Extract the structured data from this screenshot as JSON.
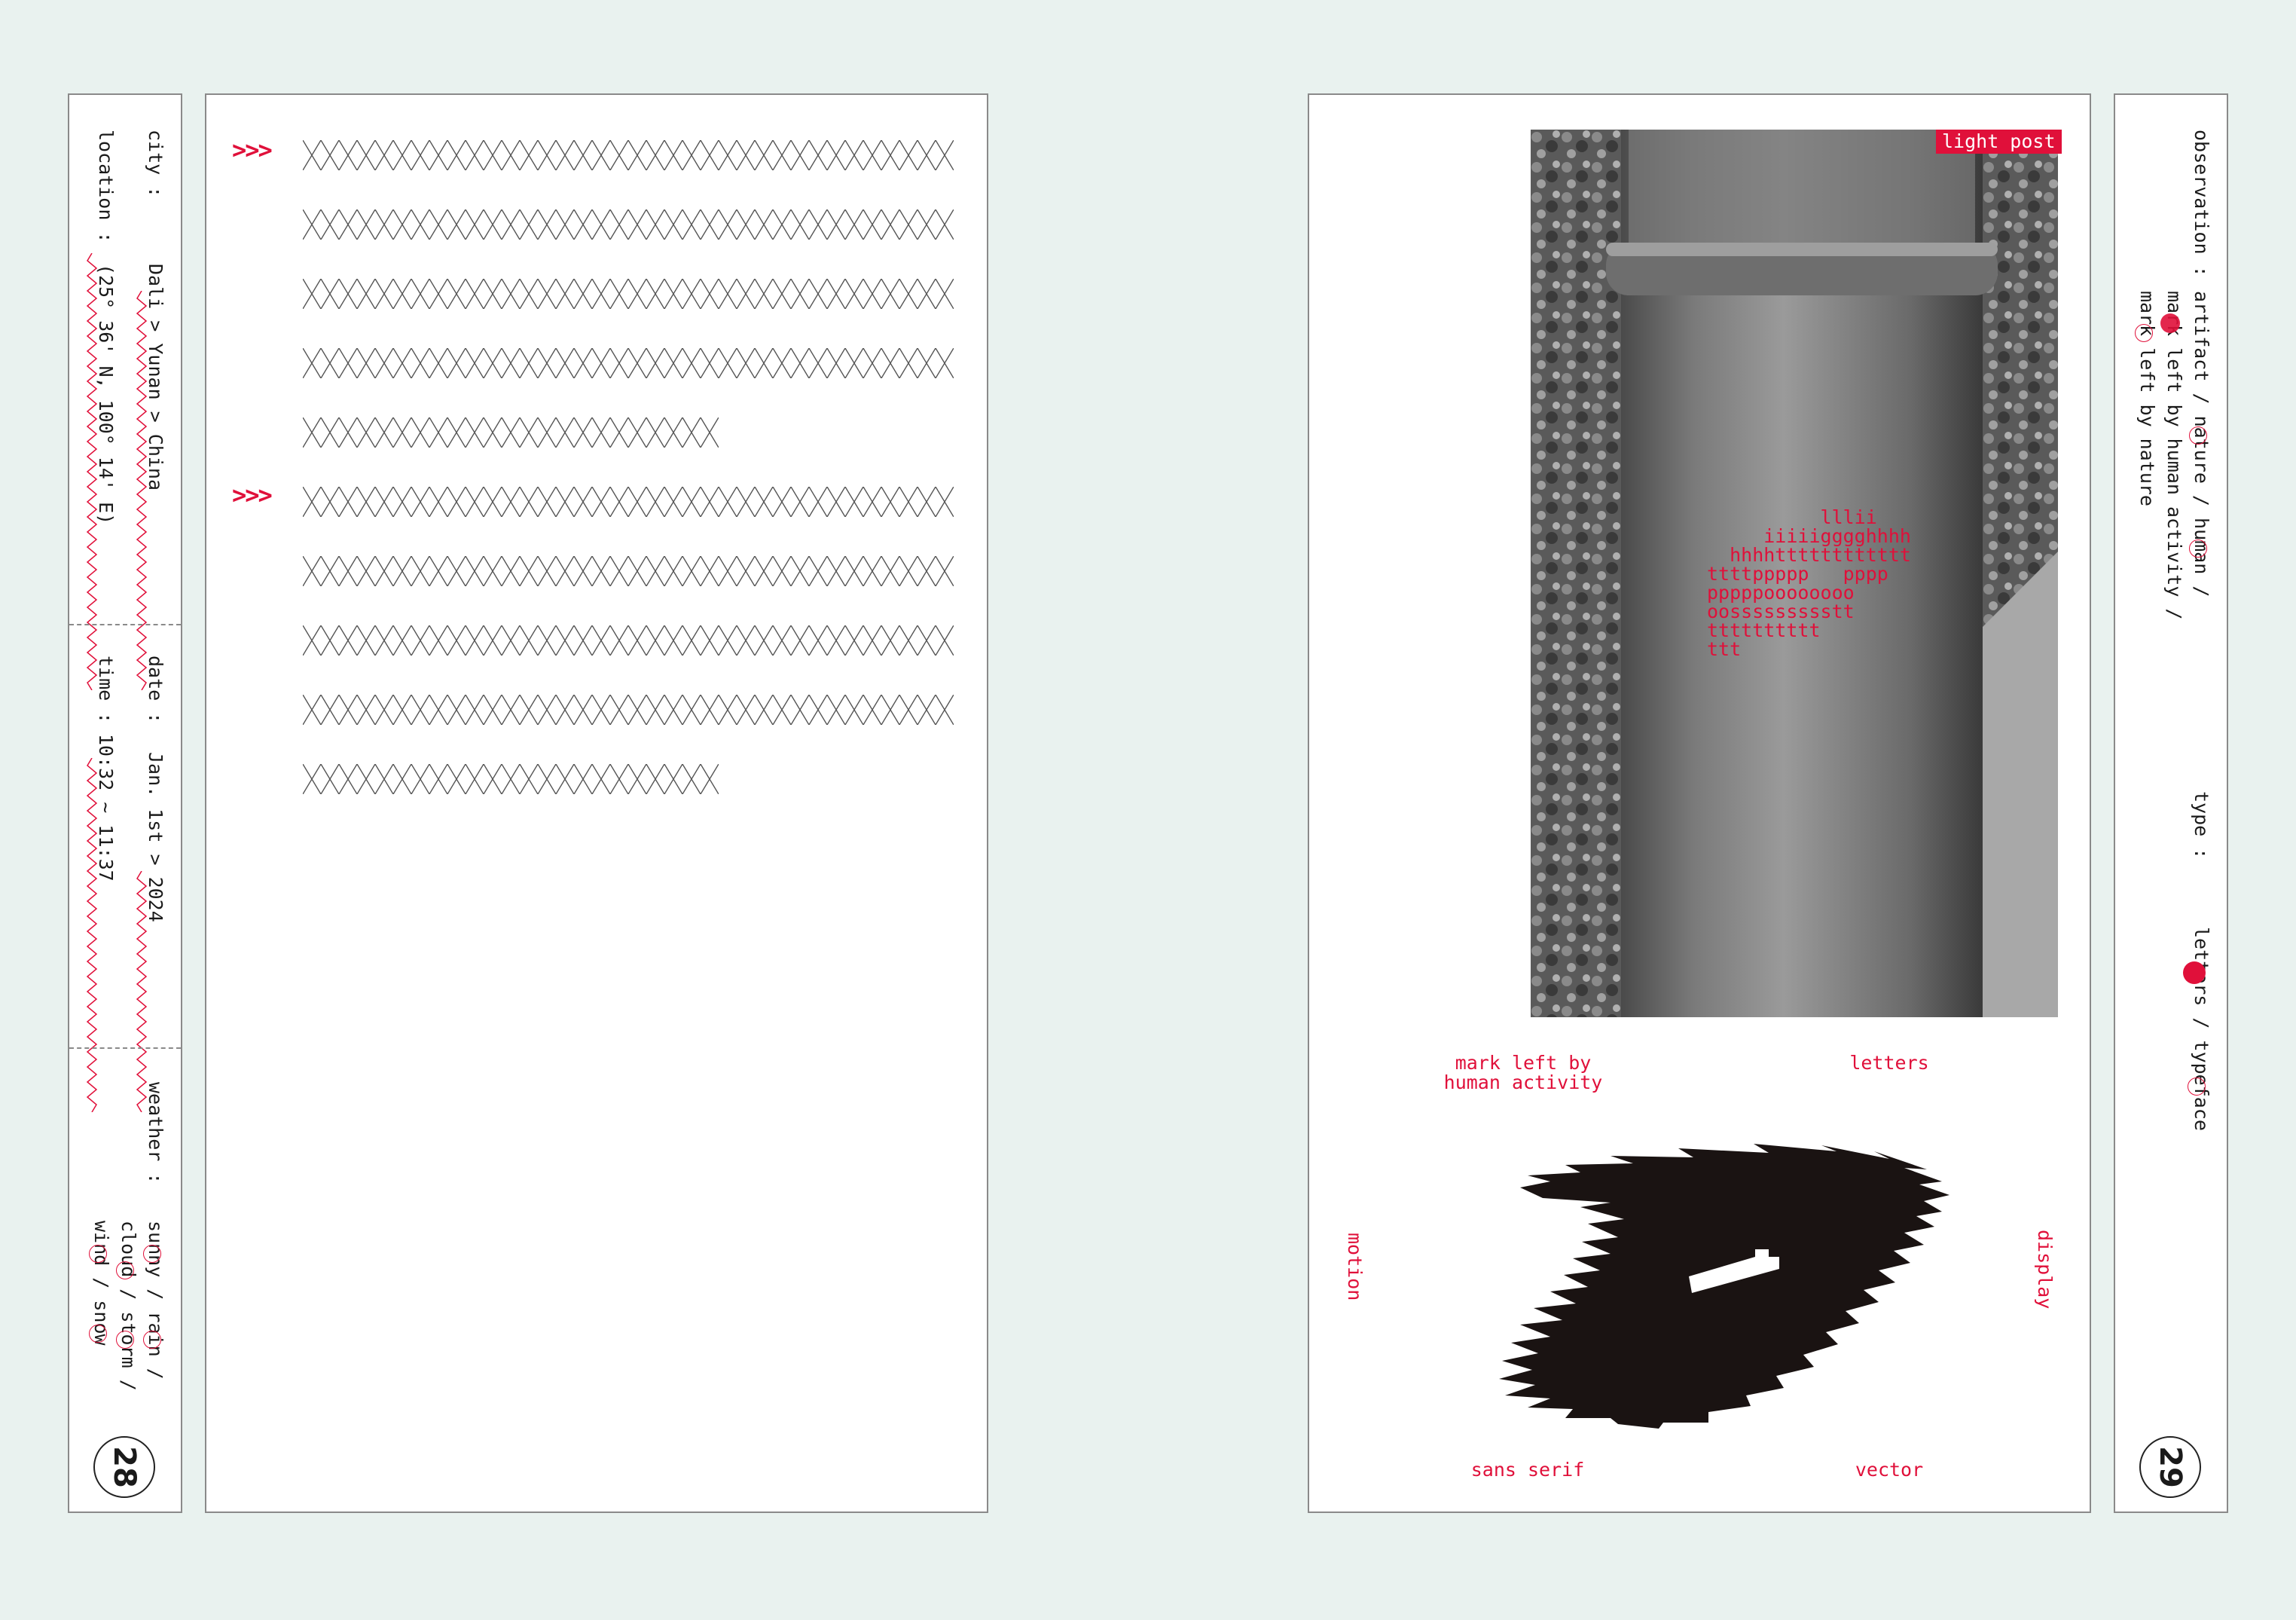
{
  "page_left": {
    "number": "28",
    "sidebar": {
      "city_label": "city :",
      "city_value": "Dali > Yunan > China",
      "location_label": "location :",
      "location_value": "(25° 36' N, 100° 14' E)",
      "date_label": "date :",
      "date_value": "Jan. 1st > 2024",
      "time_label": "time :",
      "time_value": "10:32 ~ 11:37",
      "weather_label": "weather :",
      "weather_line1": "sunny / rain /",
      "weather_line2": "cloud / storm /",
      "weather_line3": "wind / snow"
    },
    "bullets": [
      ">>>",
      ">>>"
    ]
  },
  "page_right": {
    "number": "29",
    "sidebar": {
      "observation_label": "observation :",
      "observation_line1": "artifact / nature / human /",
      "observation_line2": "mark left by human activity /",
      "observation_line3": "mark left by nature",
      "type_label": "type :",
      "type_value": "letters / typeface"
    },
    "photo_tag": "light post",
    "overlay_text": [
      "          lllii",
      "     iiiiigggghhhh",
      "  hhhhtttttttttttt",
      "ttttppppp   pppp",
      "pppppoooooooo",
      "oossssssssstt",
      "tttttttttt",
      "ttt"
    ],
    "labels": {
      "top_left": "mark left by\nhuman activity",
      "top_right": "letters",
      "left": "motion",
      "right": "display",
      "bottom_left": "sans serif",
      "bottom_right": "vector"
    }
  },
  "colors": {
    "accent": "#e0103a",
    "background": "#e9f2ef"
  }
}
